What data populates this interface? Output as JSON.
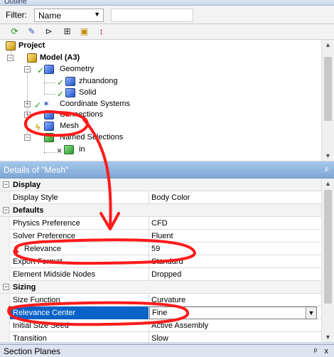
{
  "outline": {
    "title": "Outline",
    "filter_label": "Filter:",
    "filter_value": "Name",
    "toolbar_icons": [
      "refresh-icon",
      "edit-icon",
      "tree-icon",
      "expand-icon",
      "folder-icon",
      "sort-icon"
    ],
    "tree": [
      {
        "label": "Project",
        "icon": "project-icon"
      },
      {
        "label": "Model (A3)",
        "icon": "model-icon"
      },
      {
        "label": "Geometry",
        "icon": "geometry-icon"
      },
      {
        "label": "zhuandong",
        "icon": "solid-icon"
      },
      {
        "label": "Solid",
        "icon": "solid-icon"
      },
      {
        "label": "Coordinate Systems",
        "icon": "coordinate-icon"
      },
      {
        "label": "Connections",
        "icon": "connections-icon"
      },
      {
        "label": "Mesh",
        "icon": "mesh-icon"
      },
      {
        "label": "Named Selections",
        "icon": "named-selections-icon"
      },
      {
        "label": "in",
        "icon": "selection-icon"
      }
    ]
  },
  "details": {
    "title": "Details of \"Mesh\"",
    "pin": "ᵖ",
    "groups": [
      {
        "name": "Display",
        "rows": [
          {
            "label": "Display Style",
            "value": "Body Color"
          }
        ]
      },
      {
        "name": "Defaults",
        "rows": [
          {
            "label": "Physics Preference",
            "value": "CFD"
          },
          {
            "label": "Solver Preference",
            "value": "Fluent"
          },
          {
            "label": "Relevance",
            "value": "59"
          },
          {
            "label": "Export Format",
            "value": "Standard"
          },
          {
            "label": "Element Midside Nodes",
            "value": "Dropped"
          }
        ]
      },
      {
        "name": "Sizing",
        "rows": [
          {
            "label": "Size Function",
            "value": "Curvature"
          },
          {
            "label": "Relevance Center",
            "value": "Fine"
          },
          {
            "label": "Initial Size Seed",
            "value": "Active Assembly"
          },
          {
            "label": "Transition",
            "value": "Slow"
          }
        ]
      }
    ]
  },
  "bottom": {
    "title": "Section Planes",
    "pin": "ᵖ",
    "close": "x"
  },
  "colors": {
    "selection": "#0a63c8",
    "annotation": "#ff1a1a",
    "titlebar": "#8fb3de"
  }
}
